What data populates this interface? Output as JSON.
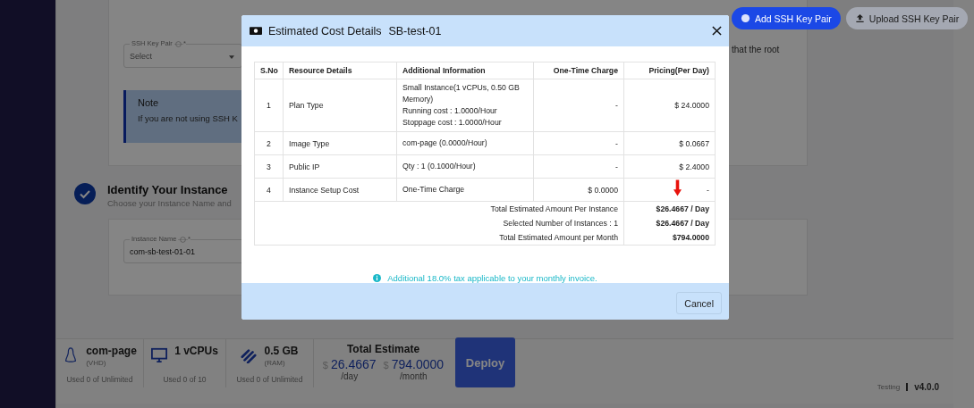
{
  "background": {
    "ssh_buttons": [
      {
        "label": "Add SSH Key Pair",
        "kind": "primary"
      },
      {
        "label": "Upload SSH Key Pair",
        "kind": "secondary"
      }
    ],
    "ssh_field": {
      "label": "SSH Key Pair",
      "required_mark": "*",
      "placeholder": "Select"
    },
    "hint_text": "that the root",
    "note": {
      "title": "Note",
      "text": "If you are not using SSH K"
    },
    "step": {
      "title": "Identify Your Instance",
      "subtitle": "Choose your Instance Name and",
      "done": true
    },
    "instance_field": {
      "label": "Instance Name",
      "required_mark": "*",
      "value": "com-sb-test-01-01"
    }
  },
  "summary_bar": {
    "resources": [
      {
        "kind": "os",
        "value": "com-page",
        "unit": "(VHD)",
        "usage": "Used 0 of Unlimited"
      },
      {
        "kind": "cpu",
        "value": "1 vCPUs",
        "usage": "Used 0 of 10"
      },
      {
        "kind": "ram",
        "value": "0.5 GB",
        "unit": "(RAM)",
        "usage": "Used 0 of Unlimited"
      }
    ],
    "total": {
      "title": "Total Estimate",
      "currency": "$",
      "daily": "26.4667",
      "daily_unit": "/day",
      "monthly": "794.0000",
      "monthly_unit": "/month"
    },
    "deploy": "Deploy"
  },
  "footer": {
    "env": "Testing",
    "version": "v4.0.0"
  },
  "modal": {
    "title": "Estimated Cost Details",
    "subtitle": "SB-test-01",
    "columns": [
      "S.No",
      "Resource Details",
      "Additional Information",
      "One-Time Charge",
      "Pricing(Per Day)"
    ],
    "rows": [
      {
        "sno": "1",
        "resource": "Plan Type",
        "info": "Small Instance(1 vCPUs, 0.50 GB Memory)\nRunning cost : 1.0000/Hour\nStoppage cost : 1.0000/Hour",
        "one_time": "-",
        "pricing": "$ 24.0000",
        "arrow": false
      },
      {
        "sno": "2",
        "resource": "Image Type",
        "info": "com-page (0.0000/Hour)",
        "one_time": "-",
        "pricing": "$ 0.0667",
        "arrow": false
      },
      {
        "sno": "3",
        "resource": "Public IP",
        "info": "Qty : 1 (0.1000/Hour)",
        "one_time": "-",
        "pricing": "$ 2.4000",
        "arrow": false
      },
      {
        "sno": "4",
        "resource": "Instance Setup Cost",
        "info": "One-Time Charge",
        "one_time": "$ 0.0000",
        "pricing": "-",
        "arrow": true
      }
    ],
    "totals": [
      {
        "label": "Total Estimated Amount Per Instance",
        "value": "$26.4667 / Day"
      },
      {
        "label": "Selected Number of Instances : 1",
        "value": "$26.4667 / Day"
      },
      {
        "label": "Total Estimated Amount per Month",
        "value": "$794.0000"
      }
    ],
    "tax_note": "Additional 18.0% tax applicable to your monthly invoice.",
    "cancel": "Cancel"
  }
}
